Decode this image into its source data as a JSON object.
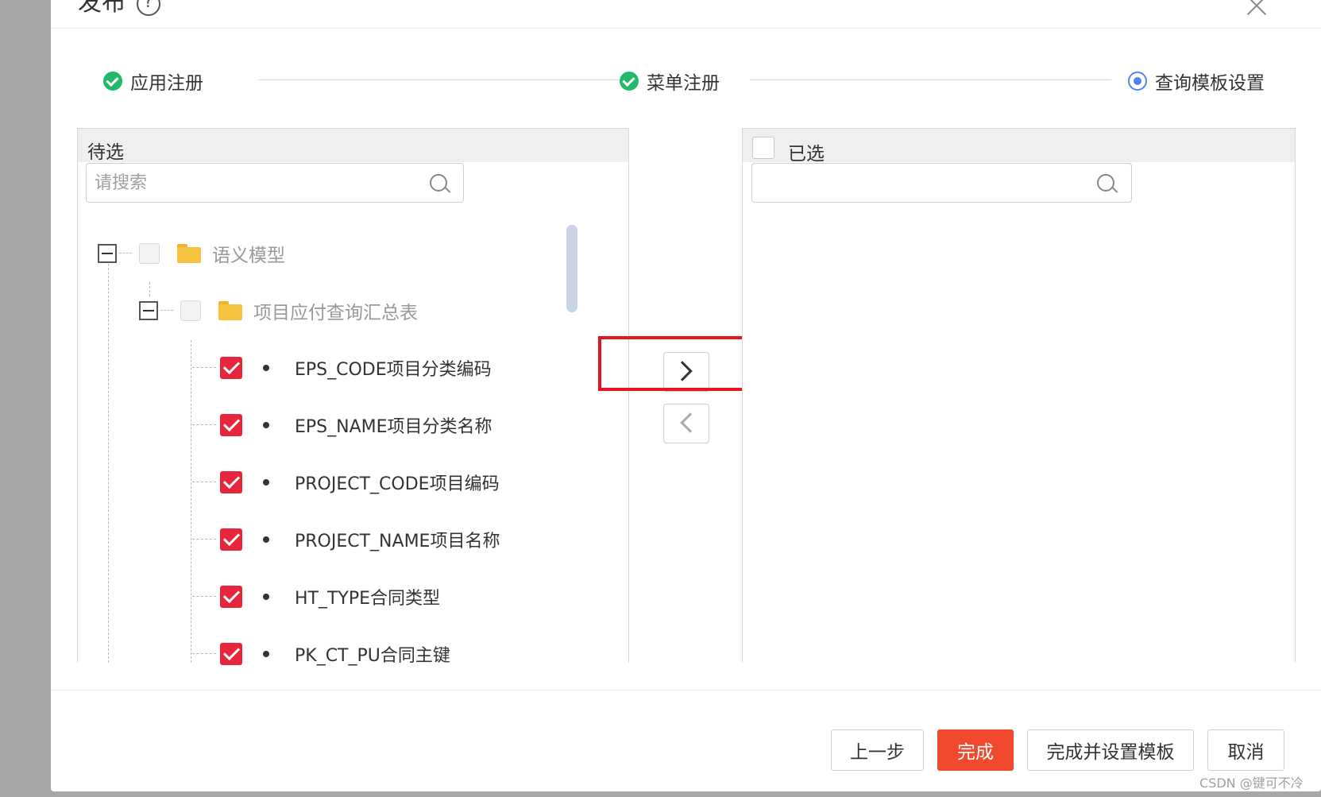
{
  "dialog": {
    "title": "发布",
    "help_icon": "help-circle-icon",
    "close_icon": "close-icon"
  },
  "steps": [
    {
      "label": "应用注册",
      "status": "done"
    },
    {
      "label": "菜单注册",
      "status": "done"
    },
    {
      "label": "查询模板设置",
      "status": "current"
    }
  ],
  "left_panel": {
    "title": "待选",
    "search_placeholder": "请搜索",
    "tree": {
      "root": {
        "label": "语义模型",
        "expanded": true
      },
      "child": {
        "label": "项目应付查询汇总表",
        "expanded": true
      },
      "leaves": [
        {
          "label": "EPS_CODE项目分类编码",
          "checked": true
        },
        {
          "label": "EPS_NAME项目分类名称",
          "checked": true
        },
        {
          "label": "PROJECT_CODE项目编码",
          "checked": true
        },
        {
          "label": "PROJECT_NAME项目名称",
          "checked": true
        },
        {
          "label": "HT_TYPE合同类型",
          "checked": true
        },
        {
          "label": "PK_CT_PU合同主键",
          "checked": true
        }
      ]
    }
  },
  "right_panel": {
    "title": "已选",
    "search_placeholder": ""
  },
  "transfer": {
    "to_right_icon": "chevron-right-icon",
    "to_left_icon": "chevron-left-icon"
  },
  "footer": {
    "prev_label": "上一步",
    "finish_label": "完成",
    "finish_and_set_label": "完成并设置模板",
    "cancel_label": "取消"
  },
  "watermark": "CSDN @键可不冷",
  "colors": {
    "primary": "#f0492e",
    "check": "#e8263b",
    "step_done": "#21b96c",
    "step_current": "#4f86ee",
    "highlight": "#e8141f"
  }
}
